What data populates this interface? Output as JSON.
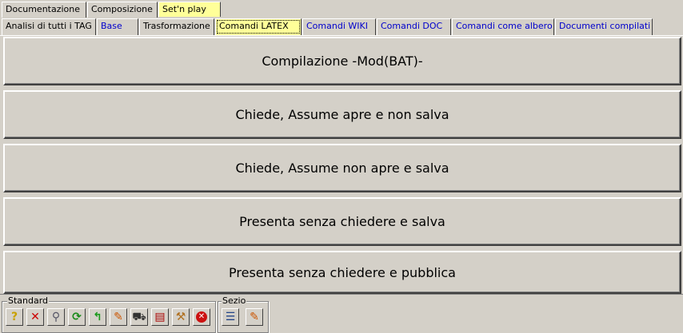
{
  "top_tabs": [
    {
      "label": "Documentazione"
    },
    {
      "label": "Composizione"
    },
    {
      "label": "Set'n play"
    }
  ],
  "sub_tabs": [
    {
      "label": "Analisi di tutti i TAG"
    },
    {
      "label": "Base"
    },
    {
      "label": "Trasformazione"
    },
    {
      "label": "Comandi LATEX"
    },
    {
      "label": "Comandi WIKI"
    },
    {
      "label": "Comandi DOC"
    },
    {
      "label": "Comandi come albero"
    },
    {
      "label": "Documenti compilati"
    }
  ],
  "actions": [
    {
      "label": "Compilazione -Mod(BAT)-"
    },
    {
      "label": "Chiede, Assume apre e non salva"
    },
    {
      "label": "Chiede, Assume non apre e salva"
    },
    {
      "label": "Presenta senza chiedere e salva"
    },
    {
      "label": "Presenta senza chiedere e pubblica"
    }
  ],
  "toolbar": {
    "standard_label": "Standard",
    "sezioni_label": "Sezio",
    "icons": [
      "help-icon",
      "delete-icon",
      "search-icon",
      "refresh-icon",
      "undo-icon",
      "edit-icon",
      "cart-icon",
      "export-icon",
      "tools-icon",
      "stop-icon"
    ]
  },
  "colors": {
    "background": "#d4d0c8",
    "selected_tab": "#ffff99",
    "link_tab": "#0000cc"
  }
}
